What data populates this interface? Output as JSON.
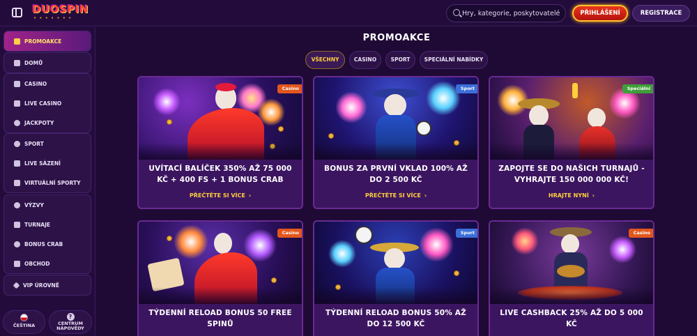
{
  "header": {
    "logo_text": "DUOSPIN",
    "logo_dots": "• • • • • • •",
    "search_placeholder": "Hry, kategorie, poskytovatelé",
    "login_label": "PŘIHLÁŠENÍ",
    "register_label": "REGISTRACE"
  },
  "sidebar": {
    "groups": [
      [
        {
          "label": "PROMOAKCE",
          "icon": "gift-icon",
          "active": true
        }
      ],
      [
        {
          "label": "DOMŮ",
          "icon": "home-icon"
        }
      ],
      [
        {
          "label": "CASINO",
          "icon": "slot-machine-icon"
        },
        {
          "label": "LIVE CASINO",
          "icon": "cards-icon"
        },
        {
          "label": "JACKPOTY",
          "icon": "clover-icon"
        }
      ],
      [
        {
          "label": "SPORT",
          "icon": "soccer-ball-icon"
        },
        {
          "label": "LIVE SÁZENÍ",
          "icon": "live-play-icon"
        },
        {
          "label": "VIRTUÁLNÍ SPORTY",
          "icon": "gamepad-icon"
        }
      ],
      [
        {
          "label": "VÝZVY",
          "icon": "medal-icon"
        },
        {
          "label": "TURNAJE",
          "icon": "trophy-icon"
        },
        {
          "label": "BONUS CRAB",
          "icon": "crab-icon"
        },
        {
          "label": "OBCHOD",
          "icon": "shop-icon"
        }
      ],
      [
        {
          "label": "VIP ÚROVNĚ",
          "icon": "diamond-icon"
        }
      ]
    ],
    "language_label": "ČEŠTINA",
    "help_label_1": "CENTRUM",
    "help_label_2": "NÁPOVĚDY"
  },
  "main": {
    "title": "PROMOAKCE",
    "filters": [
      {
        "label": "VŠECHNY",
        "active": true
      },
      {
        "label": "CASINO",
        "active": false
      },
      {
        "label": "SPORT",
        "active": false
      },
      {
        "label": "SPECIÁLNÍ NABÍDKY",
        "active": false
      }
    ],
    "cards": [
      {
        "badge": "Casino",
        "badge_type": "casino",
        "title": "UVÍTACÍ BALÍČEK 350% AŽ 75 000 KČ + 400 FS + 1 BONUS CRAB",
        "cta": "PŘEČTĚTE SI VÍCE"
      },
      {
        "badge": "Sport",
        "badge_type": "sport",
        "title": "BONUS ZA PRVNÍ VKLAD 100% AŽ DO 2 500 KČ",
        "cta": "PŘEČTĚTE SI VÍCE"
      },
      {
        "badge": "Speciální",
        "badge_type": "special",
        "title": "ZAPOJTE SE DO NAŠICH TURNAJŮ - VYHRAJTE 150 000 000 KČ!",
        "cta": "HRAJTE NYNÍ"
      },
      {
        "badge": "Casino",
        "badge_type": "casino",
        "title": "TÝDENNÍ RELOAD BONUS 50 FREE SPINŮ",
        "cta": ""
      },
      {
        "badge": "Sport",
        "badge_type": "sport",
        "title": "TÝDENNÍ RELOAD BONUS 50% AŽ DO 12 500 KČ",
        "cta": ""
      },
      {
        "badge": "Casino",
        "badge_type": "casino",
        "title": "LIVE CASHBACK 25% AŽ DO 5 000 KČ",
        "cta": ""
      }
    ],
    "cta_chevron": "›"
  },
  "colors": {
    "accent_gold": "#ffcf3d",
    "login_red": "#e8361f",
    "background": "#1f0a35"
  }
}
